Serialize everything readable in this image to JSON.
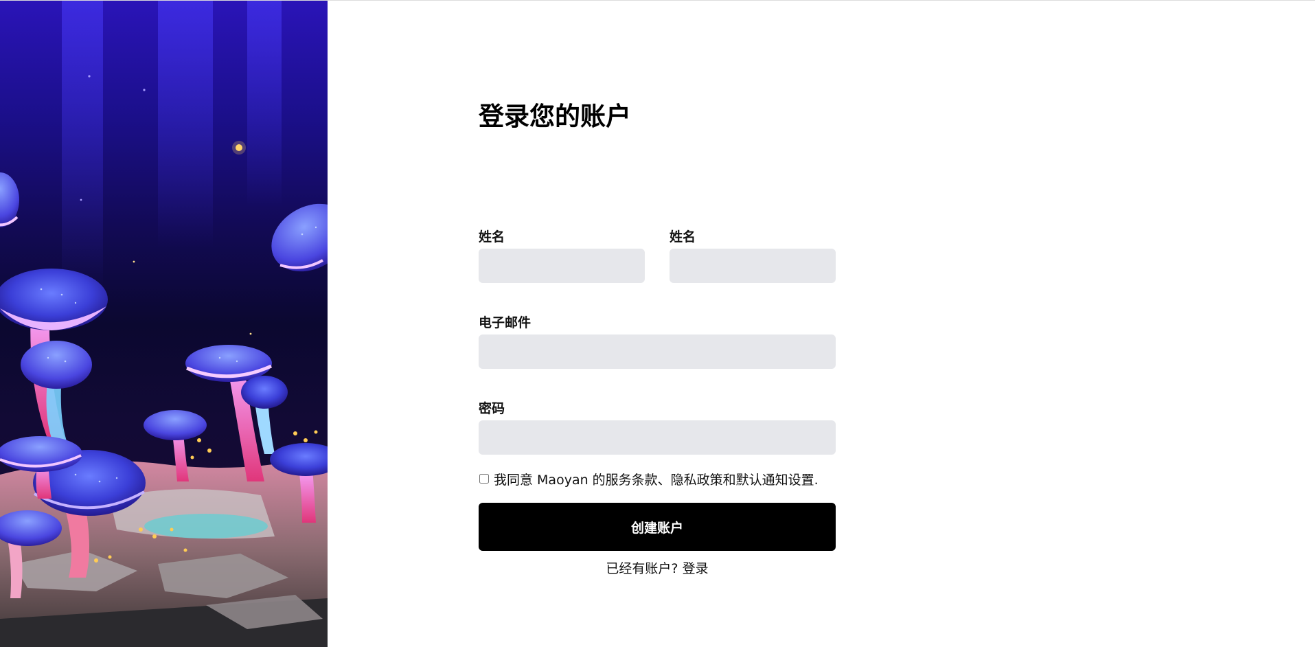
{
  "hero": {
    "image_name": "mushroom-forest-illustration"
  },
  "form": {
    "title": "登录您的账户",
    "first_name_label": "姓名",
    "last_name_label": "姓名",
    "email_label": "电子邮件",
    "password_label": "密码",
    "first_name_value": "",
    "last_name_value": "",
    "email_value": "",
    "password_value": "",
    "agree_text": "我同意 Maoyan 的服务条款、隐私政策和默认通知设置.",
    "agree_checked": false,
    "submit_label": "创建账户",
    "have_account_text": "已经有账户?",
    "signin_link": "登录"
  },
  "colors": {
    "input_bg": "#e6e7eb",
    "button_bg": "#000000",
    "button_text": "#ffffff",
    "hero_top": "#2a14b8",
    "hero_bottom": "#0b0830"
  }
}
